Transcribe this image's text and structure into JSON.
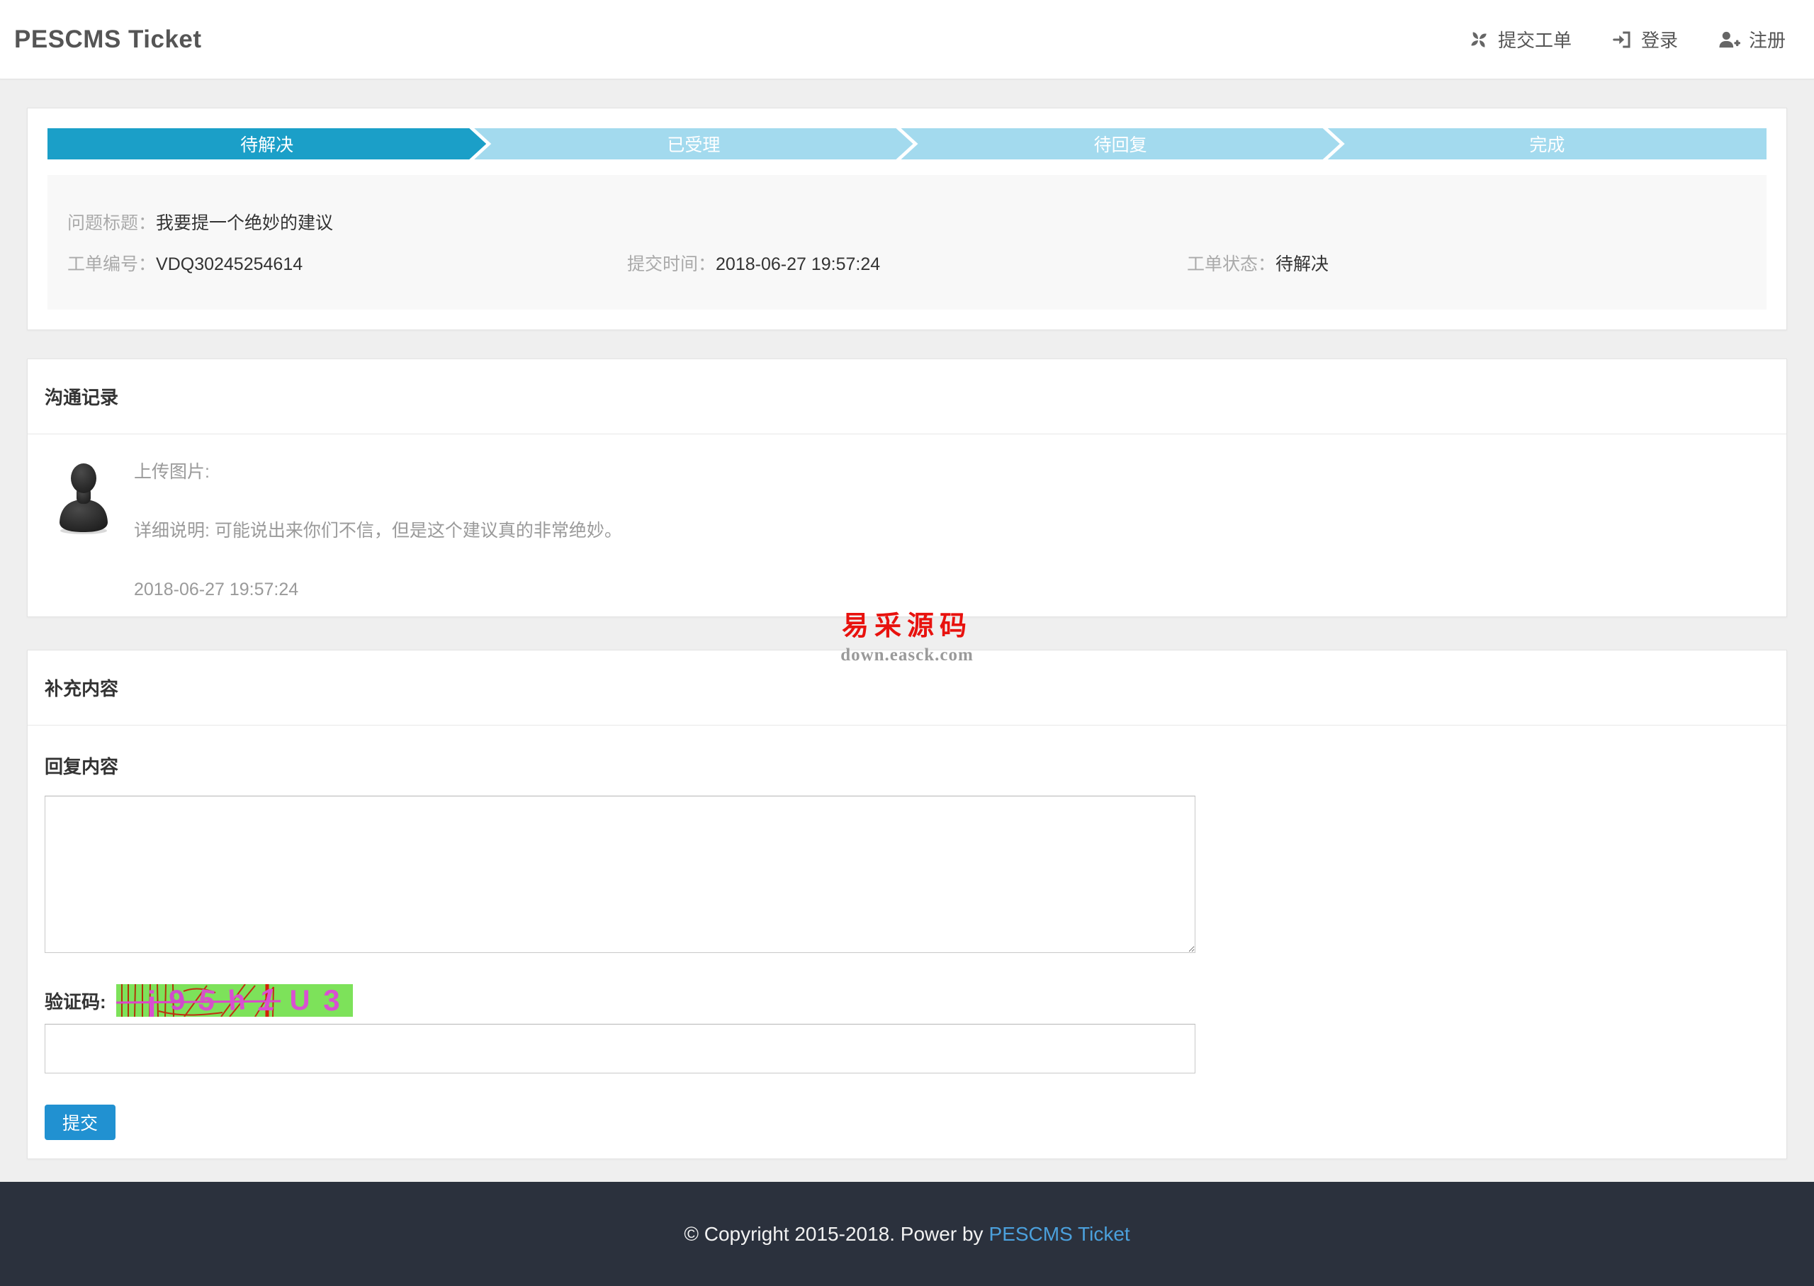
{
  "colors": {
    "step_active": "#1b9fc8",
    "step_inactive": "#a3daee",
    "submit_button": "#2191d1",
    "footer_bg": "#2b313d",
    "footer_link": "#4ba0dc",
    "captcha_bg": "#7de25a",
    "captcha_text": "#d94fd2",
    "watermark_red": "#e8120e"
  },
  "header": {
    "title": "PESCMS Ticket",
    "nav": [
      {
        "label": "提交工单",
        "icon": "pinwheel-icon"
      },
      {
        "label": "登录",
        "icon": "sign-in-icon"
      },
      {
        "label": "注册",
        "icon": "user-plus-icon"
      }
    ]
  },
  "progress": {
    "steps": [
      {
        "label": "待解决",
        "active": true
      },
      {
        "label": "已受理",
        "active": false
      },
      {
        "label": "待回复",
        "active": false
      },
      {
        "label": "完成",
        "active": false
      }
    ]
  },
  "ticket": {
    "title_label": "问题标题：",
    "title_value": "我要提一个绝妙的建议",
    "number_label": "工单编号：",
    "number_value": "VDQ30245254614",
    "time_label": "提交时间：",
    "time_value": "2018-06-27 19:57:24",
    "status_label": "工单状态：",
    "status_value": "待解决"
  },
  "communication": {
    "heading": "沟通记录",
    "messages": [
      {
        "upload_label": "上传图片:",
        "detail": "详细说明: 可能说出来你们不信，但是这个建议真的非常绝妙。",
        "time": "2018-06-27 19:57:24"
      }
    ]
  },
  "watermark": {
    "title": "易采源码",
    "domain": "down.easck.com"
  },
  "supplement": {
    "heading": "补充内容",
    "reply_label": "回复内容",
    "reply_value": "",
    "captcha_label": "验证码:",
    "captcha_text": "j95h1U3",
    "captcha_chars": [
      "j",
      "9",
      "5",
      "h",
      "1",
      "U",
      "3"
    ],
    "captcha_input_value": "",
    "submit_label": "提交"
  },
  "footer": {
    "copyright": "© Copyright 2015-2018. Power by",
    "link_label": "PESCMS Ticket"
  }
}
